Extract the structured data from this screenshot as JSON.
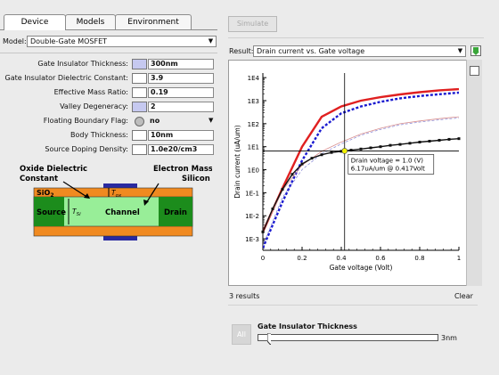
{
  "tabs": [
    {
      "label": "Device",
      "active": true
    },
    {
      "label": "Models",
      "active": false
    },
    {
      "label": "Environment",
      "active": false
    }
  ],
  "model": {
    "label": "Model:",
    "value": "Double-Gate MOSFET"
  },
  "params": [
    {
      "label": "Gate Insulator Thickness:",
      "value": "300nm",
      "swatch": "blue"
    },
    {
      "label": "Gate Insulator Dielectric Constant:",
      "value": "3.9",
      "swatch": "white"
    },
    {
      "label": "Effective Mass Ratio:",
      "value": "0.19",
      "swatch": "white"
    },
    {
      "label": "Valley Degeneracy:",
      "value": "2",
      "swatch": "blue"
    }
  ],
  "floating": {
    "label": "Floating Boundary Flag:",
    "value": "no"
  },
  "params2": [
    {
      "label": "Body Thickness:",
      "value": "10nm"
    },
    {
      "label": "Source Doping Density:",
      "value": "1.0e20/cm3"
    }
  ],
  "diagram": {
    "oxide_label_1": "Oxide Dielectric",
    "oxide_label_2": "Constant",
    "electron_label_1": "Electron Masses in",
    "electron_label_2": "Silicon",
    "sio2": "SiO",
    "sio2_sub": "2",
    "tox": "T",
    "tox_sub": "ox",
    "tsi": "T",
    "tsi_sub": "Si",
    "source": "Source",
    "channel": "Channel",
    "drain": "Drain"
  },
  "simulate_label": "Simulate",
  "result": {
    "label": "Result:",
    "value": "Drain current vs. Gate voltage"
  },
  "chart_data": {
    "type": "line",
    "xlabel": "Gate voltage (Volt)",
    "ylabel": "Drain current (uA/um)",
    "x_ticks": [
      "0",
      "0.2",
      "0.4",
      "0.6",
      "0.8",
      "1"
    ],
    "y_ticks": [
      "1E4",
      "1E3",
      "1E2",
      "1E1",
      "1E0",
      "1E-1",
      "1E-2",
      "1E-3"
    ],
    "xlim": [
      0,
      1
    ],
    "ylim_log10": [
      -3.5,
      4.2
    ],
    "series": [
      {
        "color": "#e02020",
        "style": "solid",
        "width": 2.4,
        "x": [
          0,
          0.1,
          0.2,
          0.3,
          0.4,
          0.5,
          0.6,
          0.7,
          0.8,
          0.9,
          1.0
        ],
        "log10_y": [
          -2.7,
          -0.8,
          1.0,
          2.3,
          2.75,
          3.0,
          3.15,
          3.27,
          3.37,
          3.45,
          3.5
        ]
      },
      {
        "color": "#1a1ad0",
        "style": "dashed",
        "width": 2.4,
        "x": [
          0,
          0.1,
          0.2,
          0.3,
          0.4,
          0.5,
          0.6,
          0.7,
          0.8,
          0.9,
          1.0
        ],
        "log10_y": [
          -3.4,
          -1.4,
          0.4,
          1.8,
          2.45,
          2.75,
          2.95,
          3.1,
          3.2,
          3.28,
          3.35
        ]
      },
      {
        "color": "#d89090",
        "style": "solid",
        "width": 0.8,
        "x": [
          0,
          0.1,
          0.2,
          0.3,
          0.4,
          0.5,
          0.6,
          0.7,
          0.8,
          0.9,
          1.0
        ],
        "log10_y": [
          -2.7,
          -0.9,
          0.2,
          0.8,
          1.2,
          1.55,
          1.8,
          2.0,
          2.12,
          2.22,
          2.3
        ]
      },
      {
        "color": "#9090d8",
        "style": "dashed",
        "width": 0.8,
        "x": [
          0,
          0.1,
          0.2,
          0.3,
          0.4,
          0.5,
          0.6,
          0.7,
          0.8,
          0.9,
          1.0
        ],
        "log10_y": [
          -3.3,
          -1.2,
          0.0,
          0.7,
          1.12,
          1.5,
          1.75,
          1.95,
          2.07,
          2.17,
          2.25
        ]
      },
      {
        "color": "#111111",
        "style": "solid",
        "width": 1.4,
        "markers": true,
        "x": [
          0,
          0.05,
          0.1,
          0.15,
          0.2,
          0.25,
          0.3,
          0.35,
          0.4,
          0.45,
          0.5,
          0.55,
          0.6,
          0.65,
          0.7,
          0.75,
          0.8,
          0.85,
          0.9,
          0.95,
          1.0
        ],
        "log10_y": [
          -2.7,
          -1.7,
          -0.85,
          -0.2,
          0.25,
          0.5,
          0.65,
          0.75,
          0.8,
          0.85,
          0.9,
          0.95,
          1.0,
          1.06,
          1.1,
          1.15,
          1.2,
          1.24,
          1.28,
          1.32,
          1.35
        ]
      }
    ],
    "crosshair": {
      "x": 0.417
    },
    "annotation": {
      "line1": "Drain voltage = 1.0 (V)",
      "line2": "6.17uA/um @ 0.417Volt"
    }
  },
  "results_count": "3 results",
  "clear_label": "Clear",
  "all_label": "All",
  "slider": {
    "label": "Gate Insulator Thickness",
    "value": "3nm",
    "fraction": 0.07
  },
  "colors": {
    "oxide": "#f08a20",
    "silicon": "#98ee98",
    "contact": "#1c8c1c",
    "gate": "#2a2aa0"
  }
}
